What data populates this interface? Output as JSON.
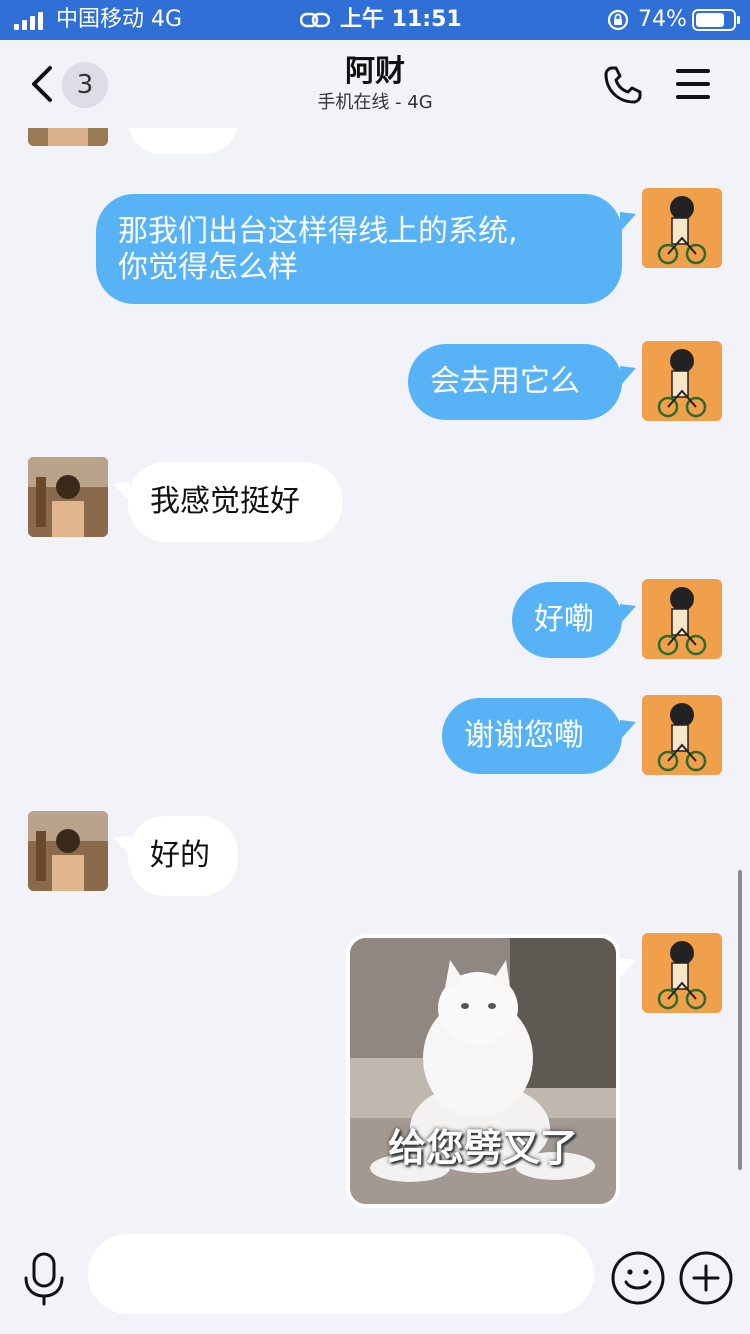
{
  "status": {
    "carrier": "中国移动  4G",
    "time": "上午 11:51",
    "battery": "74%"
  },
  "nav": {
    "back_count": "3",
    "title": "阿财",
    "subtitle": "手机在线 - 4G"
  },
  "messages": [
    {
      "from": "me",
      "text_line1": "那我们出台这样得线上的系统,",
      "text_line2": "你觉得怎么样"
    },
    {
      "from": "me",
      "text": "会去用它么"
    },
    {
      "from": "other",
      "text": "我感觉挺好"
    },
    {
      "from": "me",
      "text": "好嘞"
    },
    {
      "from": "me",
      "text": "谢谢您嘞"
    },
    {
      "from": "other",
      "text": "好的"
    },
    {
      "from": "me",
      "image_caption": "给您劈叉了"
    }
  ],
  "input": {
    "placeholder": ""
  },
  "colors": {
    "status_bar": "#2f6fd6",
    "outgoing_bubble": "#58b3f6",
    "incoming_bubble": "#ffffff",
    "background": "#f2f3f9"
  },
  "icons": {
    "signal": "signal-bars-icon",
    "link": "link-icon",
    "rotation_lock": "rotation-lock-icon",
    "battery": "battery-icon",
    "back": "chevron-left-icon",
    "phone": "phone-icon",
    "menu": "hamburger-menu-icon",
    "mic": "microphone-icon",
    "emoji": "emoji-icon",
    "plus": "plus-icon"
  }
}
